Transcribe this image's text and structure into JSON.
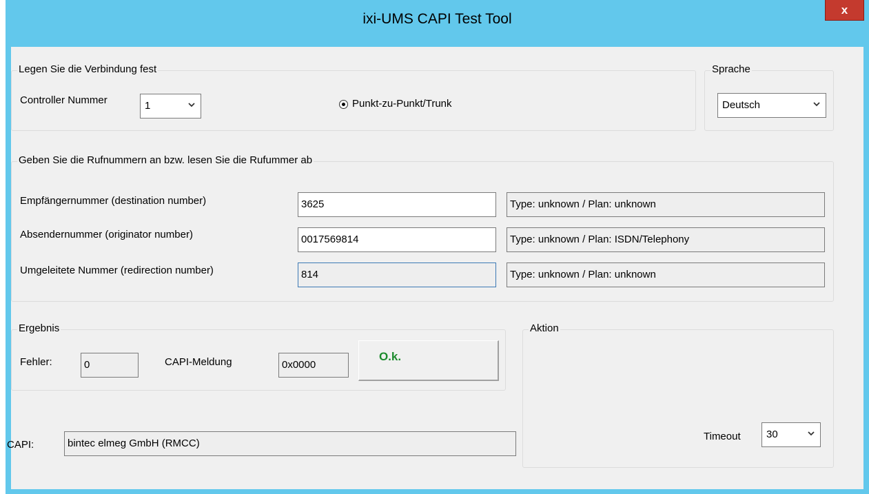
{
  "window": {
    "title": "ixi-UMS CAPI Test Tool",
    "close_label": "x"
  },
  "connection": {
    "legend": "Legen Sie die Verbindung fest",
    "controller_label": "Controller Nummer",
    "controller_value": "1",
    "mode_label": "Punkt-zu-Punkt/Trunk",
    "mode_selected": true
  },
  "language": {
    "legend": "Sprache",
    "value": "Deutsch"
  },
  "numbers": {
    "legend": "Geben Sie die Rufnummern an bzw. lesen Sie die Rufummer ab",
    "rows": [
      {
        "label": "Empfängernummer (destination number)",
        "value": "3625",
        "type_plan": "Type: unknown /  Plan: unknown"
      },
      {
        "label": "Absendernummer (originator number)",
        "value": "0017569814",
        "type_plan": "Type: unknown / Plan: ISDN/Telephony"
      },
      {
        "label": "Umgeleitete Nummer (redirection number)",
        "value": "814",
        "type_plan": "Type: unknown /  Plan: unknown"
      }
    ]
  },
  "result": {
    "legend": "Ergebnis",
    "error_label": "Fehler:",
    "error_value": "0",
    "capi_msg_label": "CAPI-Meldung",
    "capi_msg_value": "0x0000",
    "status_text": "O.k.",
    "status_color": "#1d8b2e"
  },
  "action": {
    "legend": "Aktion",
    "timeout_label": "Timeout",
    "timeout_value": "30"
  },
  "capi": {
    "label": "CAPI:",
    "value": "bintec elmeg GmbH (RMCC)"
  },
  "colors": {
    "titlebar": "#62c8ec",
    "close_button": "#c43a2e",
    "dialog_bg": "#f0f0f0"
  }
}
